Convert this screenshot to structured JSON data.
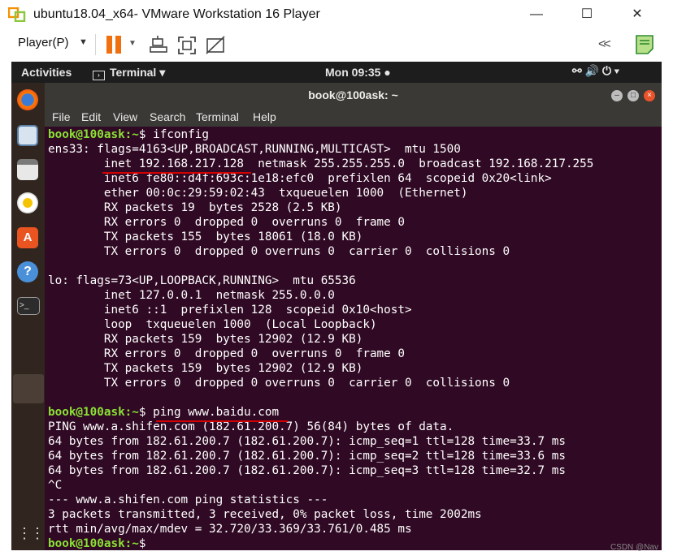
{
  "window": {
    "title": "ubuntu18.04_x64- VMware Workstation 16 Player",
    "minimize": "—",
    "maximize": "☐",
    "close": "✕"
  },
  "vmware_toolbar": {
    "player_menu": "Player(P)",
    "icons": [
      "pause-icon",
      "send-keys-icon",
      "full-screen-icon",
      "unity-icon",
      "back-icon",
      "notes-icon"
    ],
    "accent": "#f0700f"
  },
  "gnome": {
    "activities": "Activities",
    "app_indicator": "Terminal ▾",
    "clock": "Mon 09:35 ●",
    "system_icons": "⚯  🔊  ⏻ ▾"
  },
  "terminal": {
    "title": "book@100ask: ~",
    "menu": [
      "File",
      "Edit",
      "View",
      "Search",
      "Terminal",
      "Help"
    ],
    "prompt": "book@100ask:~$",
    "lines": [
      {
        "prompt": "book@100ask:~",
        "text": "$ ifconfig"
      },
      {
        "text": "ens33: flags=4163<UP,BROADCAST,RUNNING,MULTICAST>  mtu 1500"
      },
      {
        "text": "        inet 192.168.217.128  netmask 255.255.255.0  broadcast 192.168.217.255"
      },
      {
        "text": "        inet6 fe80::d4f:693c:1e18:efc0  prefixlen 64  scopeid 0x20<link>"
      },
      {
        "text": "        ether 00:0c:29:59:02:43  txqueuelen 1000  (Ethernet)"
      },
      {
        "text": "        RX packets 19  bytes 2528 (2.5 KB)"
      },
      {
        "text": "        RX errors 0  dropped 0  overruns 0  frame 0"
      },
      {
        "text": "        TX packets 155  bytes 18061 (18.0 KB)"
      },
      {
        "text": "        TX errors 0  dropped 0 overruns 0  carrier 0  collisions 0"
      },
      {
        "text": ""
      },
      {
        "text": "lo: flags=73<UP,LOOPBACK,RUNNING>  mtu 65536"
      },
      {
        "text": "        inet 127.0.0.1  netmask 255.0.0.0"
      },
      {
        "text": "        inet6 ::1  prefixlen 128  scopeid 0x10<host>"
      },
      {
        "text": "        loop  txqueuelen 1000  (Local Loopback)"
      },
      {
        "text": "        RX packets 159  bytes 12902 (12.9 KB)"
      },
      {
        "text": "        RX errors 0  dropped 0  overruns 0  frame 0"
      },
      {
        "text": "        TX packets 159  bytes 12902 (12.9 KB)"
      },
      {
        "text": "        TX errors 0  dropped 0 overruns 0  carrier 0  collisions 0"
      },
      {
        "text": ""
      },
      {
        "prompt": "book@100ask:~",
        "text": "$ ping www.baidu.com"
      },
      {
        "text": "PING www.a.shifen.com (182.61.200.7) 56(84) bytes of data."
      },
      {
        "text": "64 bytes from 182.61.200.7 (182.61.200.7): icmp_seq=1 ttl=128 time=33.7 ms"
      },
      {
        "text": "64 bytes from 182.61.200.7 (182.61.200.7): icmp_seq=2 ttl=128 time=33.6 ms"
      },
      {
        "text": "64 bytes from 182.61.200.7 (182.61.200.7): icmp_seq=3 ttl=128 time=32.7 ms"
      },
      {
        "text": "^C"
      },
      {
        "text": "--- www.a.shifen.com ping statistics ---"
      },
      {
        "text": "3 packets transmitted, 3 received, 0% packet loss, time 2002ms"
      },
      {
        "text": "rtt min/avg/max/mdev = 32.720/33.369/33.761/0.485 ms"
      },
      {
        "prompt": "book@100ask:~",
        "text": "$ "
      }
    ]
  },
  "watermark": "CSDN @Nav"
}
